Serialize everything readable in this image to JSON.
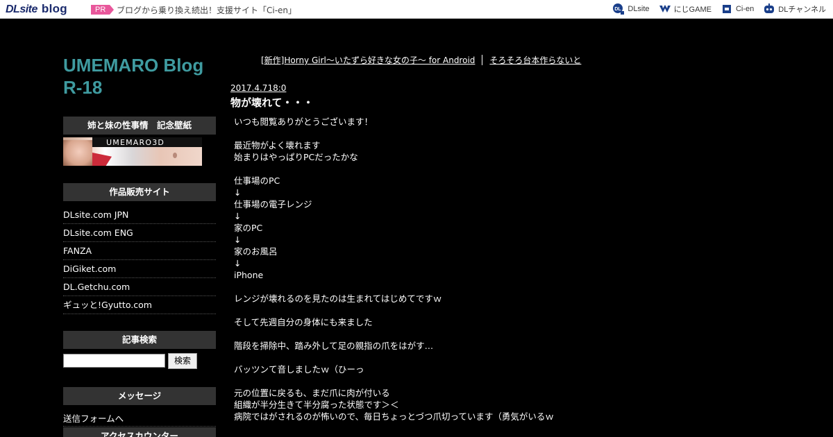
{
  "topbar": {
    "logo_dl": "DLsite",
    "logo_blog": "blog",
    "pr_badge": "PR",
    "pr_text": "ブログから乗り換え続出！支援サイト「Ci-en」",
    "nav": [
      {
        "label": "DLsite",
        "icon": "dlsite-icon",
        "color": "#1a3f8a"
      },
      {
        "label": "にじGAME",
        "icon": "nijigame-icon",
        "color": "#1a3f8a"
      },
      {
        "label": "Ci-en",
        "icon": "cien-icon",
        "color": "#1a3f8a"
      },
      {
        "label": "DLチャンネル",
        "icon": "dlchannel-icon",
        "color": "#1a3f8a"
      }
    ]
  },
  "sidebar": {
    "blog_title": "UMEMARO Blog R-18",
    "wallpaper_head": "姉と妹の性事情　記念壁紙",
    "banner_text": "UMEMARO3D",
    "sales_head": "作品販売サイト",
    "sales_sites": [
      "DLsite.com JPN",
      "DLsite.com ENG",
      "FANZA",
      "DiGiket.com",
      "DL.Getchu.com",
      "ギュッと!Gyutto.com"
    ],
    "search_head": "記事検索",
    "search_value": "",
    "search_button": "検索",
    "message_head": "メッセージ",
    "message_link": "送信フォームへ",
    "counter_head": "アクセスカウンター"
  },
  "main": {
    "prev_post": "[新作]Horny Girl～いたずら好きな女の子～ for Android",
    "next_post": "そろそろ台本作らないと",
    "post_date": "2017.4.718:0",
    "post_title": "物が壊れて・・・",
    "body_lines": [
      "いつも閲覧ありがとうございます！",
      "",
      "最近物がよく壊れます",
      "始まりはやっぱりPCだったかな",
      "",
      "仕事場のPC",
      "↓",
      "仕事場の電子レンジ",
      "↓",
      "家のPC",
      "↓",
      "家のお風呂",
      "↓",
      "iPhone",
      "",
      "レンジが壊れるのを見たのは生まれてはじめてですｗ",
      "",
      "そして先週自分の身体にも来ました",
      "",
      "階段を掃除中、踏み外して足の親指の爪をはがす…",
      "",
      "バッツンて音しましたｗ（ひーっ",
      "",
      "元の位置に戻るも、まだ爪に肉が付いる",
      "組織が半分生きて半分腐った状態です＞＜",
      "病院ではがされるのが怖いので、毎日ちょっとづつ爪切っています（勇気がいるｗ"
    ]
  },
  "colors": {
    "background": "#000000",
    "title_teal": "#3f9ba0",
    "side_head_bg": "#333333",
    "pr_pink": "#e8579b"
  }
}
